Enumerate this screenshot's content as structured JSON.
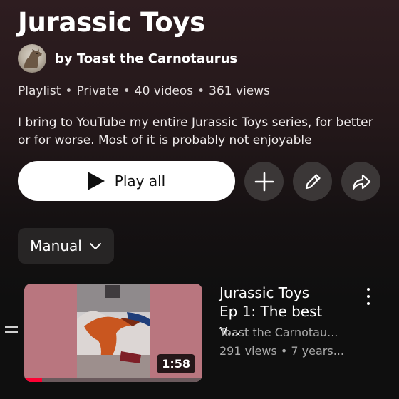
{
  "playlist": {
    "title": "Jurassic Toys",
    "author": "by Toast the Carnotaurus",
    "meta": {
      "visibility_type": "Playlist",
      "privacy": "Private",
      "video_count": "40 videos",
      "views": "361 views",
      "separator": "•"
    },
    "description": "I bring to YouTube my entire Jurassic Toys series, for better or for worse. Most of it is probably not enjoyable"
  },
  "actions": {
    "play_all_label": "Play all",
    "play_icon": "play-icon",
    "add_icon": "plus-icon",
    "edit_icon": "pencil-icon",
    "share_icon": "share-arrow-icon"
  },
  "sort": {
    "selected": "Manual",
    "icon": "chevron-down-icon"
  },
  "videos": [
    {
      "title_line1": "Jurassic Toys",
      "title_line2": "Ep 1: The best v...",
      "channel": "Toast the Carnotau...",
      "stats": "291 views • 7 years...",
      "duration": "1:58",
      "watched_fraction": 0.1
    }
  ],
  "colors": {
    "background": "#0f0f0f",
    "header_tint": "#2e1d20",
    "button_bg": "#3b3737",
    "accent_red": "#ff0033"
  }
}
